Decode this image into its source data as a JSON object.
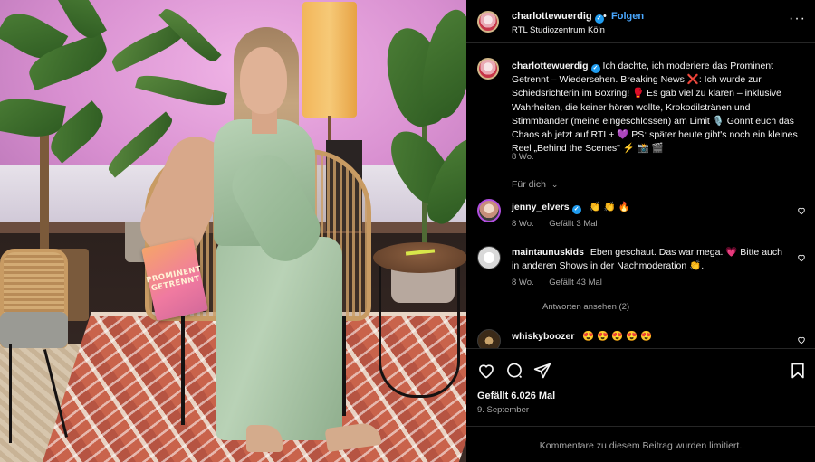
{
  "post": {
    "author": "charlottewuerdig",
    "follow_label": "Folgen",
    "location": "RTL Studiozentrum Köln",
    "more_icon": "more-horizontal-icon",
    "caption_username": "charlottewuerdig",
    "caption_text": "Ich dachte, ich moderiere das Prominent Getrennt – Wiedersehen. Breaking News ❌: Ich wurde zur Schiedsrichterin im Boxring! 🥊 Es gab viel zu klären – inklusive Wahrheiten, die keiner hören wollte, Krokodilstränen und Stimmbänder (meine eingeschlossen) am Limit 🎙️ Gönnt euch das Chaos ab jetzt auf RTL+ 💜 PS: später heute gibt's noch ein kleines Reel „Behind the Scenes\" ⚡ 📸 🎬",
    "caption_age": "8 Wo.",
    "sort_label": "Für dich",
    "card_text": [
      "PROMINENT",
      "GETRENNT"
    ]
  },
  "comments": [
    {
      "username": "jenny_elvers",
      "verified": true,
      "text": "👏 👏 🔥",
      "age": "8 Wo.",
      "likes": "Gefällt 3 Mal"
    },
    {
      "username": "maintaunuskids",
      "verified": false,
      "text": "Eben geschaut. Das war mega. 💗 Bitte auch in anderen Shows in der Nachmoderation 👏.",
      "age": "8 Wo.",
      "likes": "Gefällt 43 Mal",
      "replies": "Antworten ansehen (2)"
    },
    {
      "username": "whiskyboozer",
      "verified": false,
      "text": "😍 😍 😍 😍 😍"
    }
  ],
  "actions": {
    "like_icon": "heart-icon",
    "comment_icon": "comment-icon",
    "share_icon": "send-icon",
    "save_icon": "bookmark-icon"
  },
  "likes_total": "Gefällt 6.026 Mal",
  "post_date": "9. September",
  "footer_note": "Kommentare zu diesem Beitrag wurden limitiert.",
  "colors": {
    "link": "#4aa8ff",
    "verified": "#1f9cf0",
    "muted": "#a8a8a8",
    "background": "#000000"
  }
}
